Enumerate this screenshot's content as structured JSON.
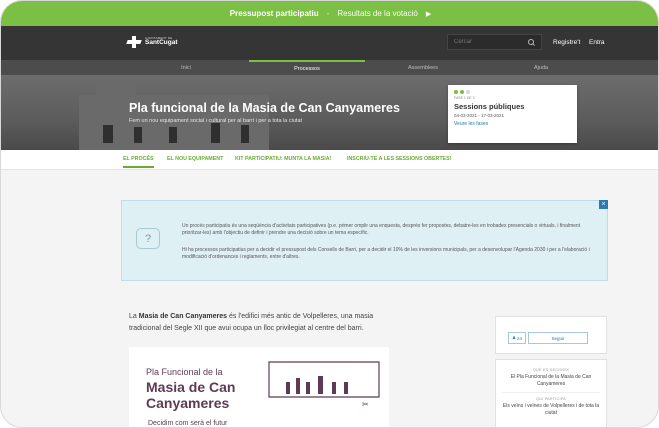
{
  "banner": {
    "main": "Pressupost participatiu",
    "separator": "-",
    "link": "Resultats de la votació",
    "arrow": "▶"
  },
  "header": {
    "logo_small": "AJUNTAMENT DE",
    "logo_name": "SantCugat",
    "search_placeholder": "Cercar",
    "register": "Registre't",
    "login": "Entra"
  },
  "nav": {
    "items": [
      {
        "label": "Inici"
      },
      {
        "label": "Processos"
      },
      {
        "label": "Assemblees"
      },
      {
        "label": "Ajuda"
      }
    ]
  },
  "hero": {
    "title": "Pla funcional de la Masia de Can Canyameres",
    "subtitle": "Fem un nou equipament social i cultural per al barri i per a tota la ciutat"
  },
  "phase": {
    "label": "FASE 1 DE 3",
    "title": "Sessions públiques",
    "dates": "04-03-2021 - 17-03-2021",
    "link": "Veure les fases",
    "current": 2,
    "total": 3
  },
  "subtabs": [
    {
      "label": "EL PROCÉS"
    },
    {
      "label": "EL NOU EQUIPAMENT"
    },
    {
      "label": "KIT PARTICIPATIU: MUNTA LA MASIA!"
    },
    {
      "label": "INSCRIU-TE A LES SESSIONS OBERTES!"
    }
  ],
  "info": {
    "icon": "question-icon",
    "close": "×",
    "p1": "Un procés participatiu és una seqüència d'activitats participatives (p.e. primer omplir una enquesta, desprès fer propostes, debatre-les en trobades presencials o virtuals, i finalment prioritzar-les) amb l'objectiu de definir i prendre una decisió sobre un tema específic.",
    "p2": "Hi ha processos participatius per a decidir el pressupost dels Consells de Barri, per a decidir el 10% de les inversions municipals, per a desenvolupar l'Agenda 2030 i per a l'elaboració i modificació d'ordenances i reglaments, entre d'altres."
  },
  "body": {
    "pre": "La ",
    "bold": "Masia de Can Canyameres",
    "post": " és l'edifici més antic de Volpelleres, una masia tradicional del Segle XII que avui ocupa un lloc privilegiat al centre del barri."
  },
  "poster": {
    "pre": "Pla Funcional de la",
    "main": "Masia de Can Canyameres",
    "tag": "Decidim com serà el futur"
  },
  "follow": {
    "count": "24",
    "follow_label": "Seguir"
  },
  "meta": {
    "decide_label": "QUÈ ES DECIDEIX",
    "decide_value": "El Pla Funcional de la Masia de Can Canyameres",
    "who_label": "QUI PARTICIPA",
    "who_value": "Els veïns i veïnes de Volpelleres i de tota la ciutat"
  },
  "colors": {
    "accent_green": "#7bbf45",
    "header_dark": "#353535",
    "link_blue": "#2a7ab8",
    "poster_purple": "#5e3b55"
  }
}
